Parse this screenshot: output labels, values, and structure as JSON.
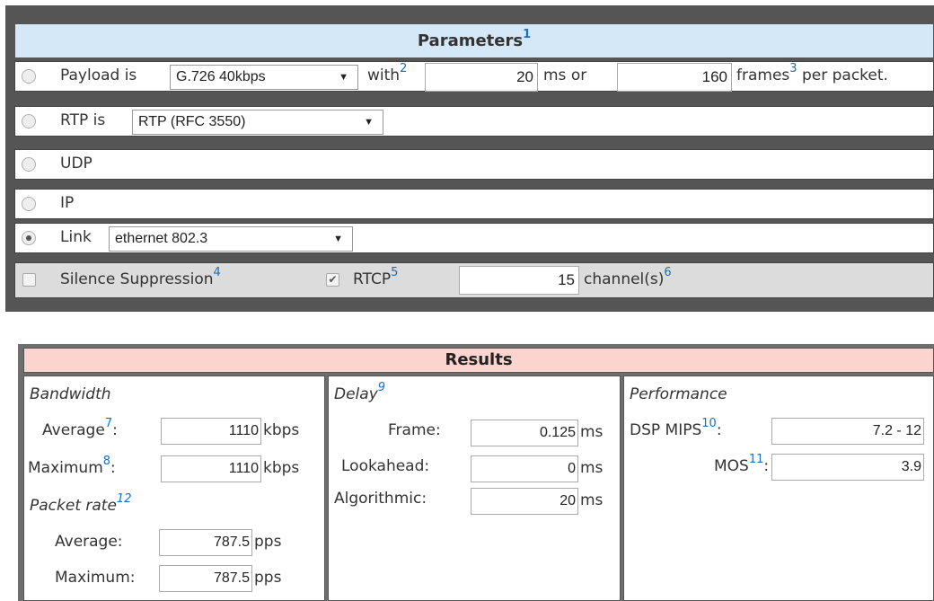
{
  "parameters": {
    "title": "Parameters",
    "title_fn": "1",
    "payload": {
      "label": "Payload is",
      "codec_selected": "G.726 40kbps",
      "with_label": "with",
      "with_fn": "2",
      "ms_value": "20",
      "ms_unit": "ms or",
      "frames_value": "160",
      "frames_label": "frames",
      "frames_fn": "3",
      "per_packet": "per packet."
    },
    "rtp": {
      "label": "RTP is",
      "selected": "RTP (RFC 3550)"
    },
    "udp": {
      "label": "UDP"
    },
    "ip": {
      "label": "IP"
    },
    "link": {
      "label": "Link",
      "selected": "ethernet 802.3"
    },
    "options": {
      "silence_label": "Silence Suppression",
      "silence_fn": "4",
      "rtcp_label": "RTCP",
      "rtcp_fn": "5",
      "channels_value": "15",
      "channels_label": "channel(s)",
      "channels_fn": "6"
    }
  },
  "results": {
    "title": "Results",
    "bandwidth": {
      "heading": "Bandwidth",
      "average_label": "Average",
      "average_fn": "7",
      "average_value": "1110",
      "average_unit": "kbps",
      "maximum_label": "Maximum",
      "maximum_fn": "8",
      "maximum_value": "1110",
      "maximum_unit": "kbps"
    },
    "packet_rate": {
      "heading": "Packet rate",
      "heading_fn": "12",
      "average_label": "Average:",
      "average_value": "787.5",
      "average_unit": "pps",
      "maximum_label": "Maximum:",
      "maximum_value": "787.5",
      "maximum_unit": "pps"
    },
    "delay": {
      "heading": "Delay",
      "heading_fn": "9",
      "frame_label": "Frame:",
      "frame_value": "0.125",
      "frame_unit": "ms",
      "lookahead_label": "Lookahead:",
      "lookahead_value": "0",
      "lookahead_unit": "ms",
      "algorithmic_label": "Algorithmic:",
      "algorithmic_value": "20",
      "algorithmic_unit": "ms"
    },
    "performance": {
      "heading": "Performance",
      "dsp_label": "DSP MIPS",
      "dsp_fn": "10",
      "dsp_value": "7.2 - 12",
      "mos_label": "MOS",
      "mos_fn": "11",
      "mos_value": "3.9"
    }
  }
}
